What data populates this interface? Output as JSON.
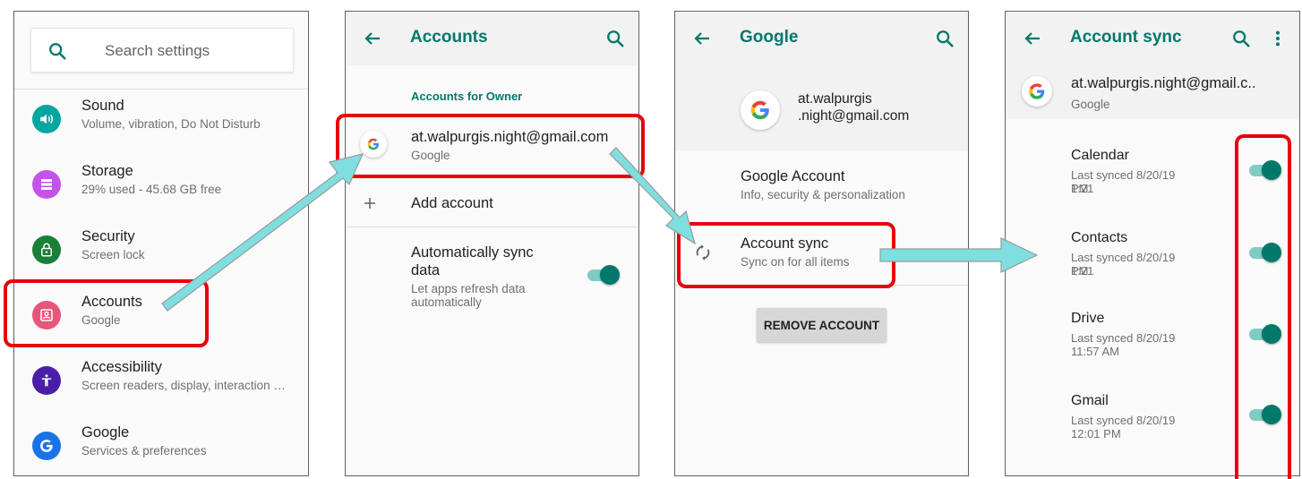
{
  "settings_screen": {
    "search_placeholder": "Search settings",
    "items": [
      {
        "title": "Sound",
        "subtitle": "Volume, vibration, Do Not Disturb",
        "icon": "volume-icon",
        "color": "#00a6a0"
      },
      {
        "title": "Storage",
        "subtitle": "29% used - 45.68 GB free",
        "icon": "storage-icon",
        "color": "#c453e8"
      },
      {
        "title": "Security",
        "subtitle": "Screen lock",
        "icon": "lock-icon",
        "color": "#188038"
      },
      {
        "title": "Accounts",
        "subtitle": "Google",
        "icon": "account-box-icon",
        "color": "#e8567c"
      },
      {
        "title": "Accessibility",
        "subtitle": "Screen readers, display, interaction …",
        "icon": "accessibility-icon",
        "color": "#4a1fa8"
      },
      {
        "title": "Google",
        "subtitle": "Services & preferences",
        "icon": "google-g-icon",
        "color": "#1a73e8"
      }
    ]
  },
  "accounts_screen": {
    "title": "Accounts",
    "section_header": "Accounts for Owner",
    "account": {
      "email": "at.walpurgis.night@gmail.com",
      "provider": "Google"
    },
    "add_account": "Add account",
    "auto_sync": {
      "title_line1": "Automatically sync",
      "title_line2": "data",
      "subtitle_line1": "Let apps refresh data",
      "subtitle_line2": "automatically",
      "enabled": true
    }
  },
  "google_screen": {
    "title": "Google",
    "email_line1": "at.walpurgis",
    "email_line2": ".night@gmail.com",
    "google_account": {
      "title": "Google Account",
      "subtitle": "Info, security & personalization"
    },
    "account_sync": {
      "title": "Account sync",
      "subtitle": "Sync on for all items"
    },
    "remove_button": "REMOVE ACCOUNT"
  },
  "account_sync_screen": {
    "title": "Account sync",
    "email": "at.walpurgis.night@gmail.c..",
    "provider": "Google",
    "items": [
      {
        "title": "Calendar",
        "line1": "Last synced 8/20/19 1:21",
        "line2": "PM",
        "enabled": true
      },
      {
        "title": "Contacts",
        "line1": "Last synced 8/20/19 1:21",
        "line2": "PM",
        "enabled": true
      },
      {
        "title": "Drive",
        "line1": "Last synced 8/20/19",
        "line2": "11:57 AM",
        "enabled": true
      },
      {
        "title": "Gmail",
        "line1": "Last synced 8/20/19",
        "line2": "12:01 PM",
        "enabled": true
      }
    ]
  },
  "colors": {
    "accent": "#00796b",
    "highlight": "#e8000b",
    "arrow": "#7fdfe0"
  }
}
